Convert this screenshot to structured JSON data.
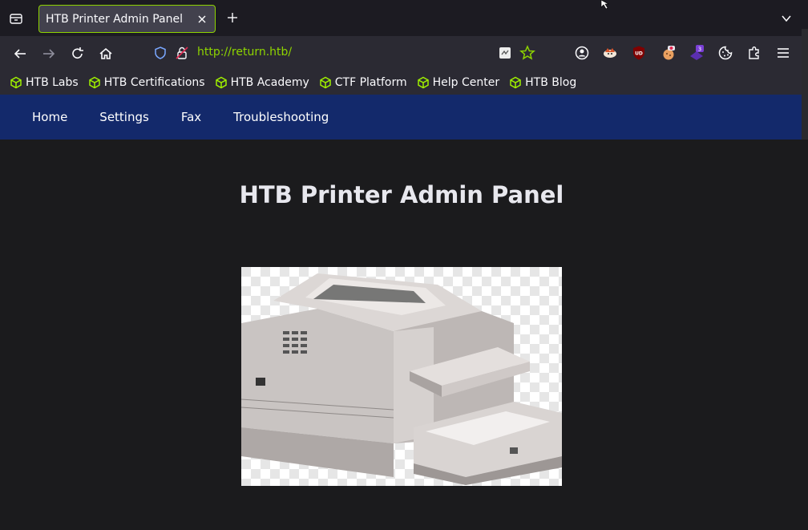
{
  "browser": {
    "tab_title": "HTB Printer Admin Panel",
    "url_scheme": "http://",
    "url_host": "return.htb",
    "url_path": "/",
    "extension_badge": "3",
    "ublock_label": "UD"
  },
  "bookmarks": [
    {
      "label": "HTB Labs"
    },
    {
      "label": "HTB Certifications"
    },
    {
      "label": "HTB Academy"
    },
    {
      "label": "CTF Platform"
    },
    {
      "label": "Help Center"
    },
    {
      "label": "HTB Blog"
    }
  ],
  "site": {
    "nav": [
      {
        "label": "Home"
      },
      {
        "label": "Settings"
      },
      {
        "label": "Fax"
      },
      {
        "label": "Troubleshooting"
      }
    ],
    "title": "HTB Printer Admin Panel"
  },
  "colors": {
    "accent": "#8ed400",
    "nav_bg": "#13296b",
    "page_bg": "#1b1b1d"
  },
  "icons": {
    "bookmark": "htb-cube-icon",
    "image": "printer-illustration"
  }
}
